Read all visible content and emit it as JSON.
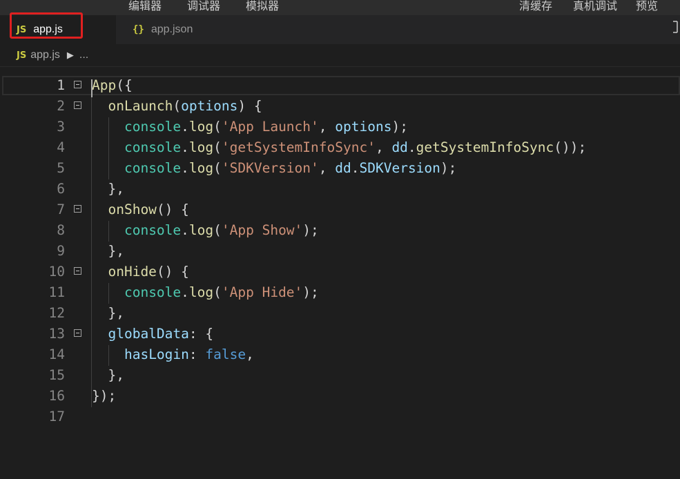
{
  "toolbar": {
    "items": [
      "编辑器",
      "调试器",
      "模拟器",
      "清缓存",
      "真机调试",
      "预览"
    ]
  },
  "tabs": [
    {
      "icon": "JS",
      "label": "app.js",
      "active": true
    },
    {
      "icon": "{}",
      "label": "app.json",
      "active": false
    }
  ],
  "tabs_action_icon": "split-editor-icon",
  "breadcrumb": {
    "icon": "JS",
    "file": "app.js",
    "separator": "▶",
    "more": "..."
  },
  "colors": {
    "highlight_box": "#e02020",
    "background": "#1e1e1e",
    "function": "#dcdcaa",
    "variable": "#9cdcfe",
    "object": "#4ec9b0",
    "string": "#ce9178",
    "keyword": "#569cd6"
  },
  "editor": {
    "active_line": 1,
    "lines": [
      {
        "n": "1",
        "fold": true,
        "tokens": [
          [
            "fn",
            "App"
          ],
          [
            "p",
            "({"
          ]
        ]
      },
      {
        "n": "2",
        "fold": true,
        "tokens": [
          [
            "p",
            "  "
          ],
          [
            "fn",
            "onLaunch"
          ],
          [
            "p",
            "("
          ],
          [
            "var",
            "options"
          ],
          [
            "p",
            ") {"
          ]
        ]
      },
      {
        "n": "3",
        "fold": false,
        "tokens": [
          [
            "p",
            "    "
          ],
          [
            "obj",
            "console"
          ],
          [
            "p",
            "."
          ],
          [
            "fn",
            "log"
          ],
          [
            "p",
            "("
          ],
          [
            "str",
            "'App Launch'"
          ],
          [
            "p",
            ", "
          ],
          [
            "var",
            "options"
          ],
          [
            "p",
            ");"
          ]
        ]
      },
      {
        "n": "4",
        "fold": false,
        "tokens": [
          [
            "p",
            "    "
          ],
          [
            "obj",
            "console"
          ],
          [
            "p",
            "."
          ],
          [
            "fn",
            "log"
          ],
          [
            "p",
            "("
          ],
          [
            "str",
            "'getSystemInfoSync'"
          ],
          [
            "p",
            ", "
          ],
          [
            "var",
            "dd"
          ],
          [
            "p",
            "."
          ],
          [
            "fn",
            "getSystemInfoSync"
          ],
          [
            "p",
            "());"
          ]
        ]
      },
      {
        "n": "5",
        "fold": false,
        "tokens": [
          [
            "p",
            "    "
          ],
          [
            "obj",
            "console"
          ],
          [
            "p",
            "."
          ],
          [
            "fn",
            "log"
          ],
          [
            "p",
            "("
          ],
          [
            "str",
            "'SDKVersion'"
          ],
          [
            "p",
            ", "
          ],
          [
            "var",
            "dd"
          ],
          [
            "p",
            "."
          ],
          [
            "var",
            "SDKVersion"
          ],
          [
            "p",
            ");"
          ]
        ]
      },
      {
        "n": "6",
        "fold": false,
        "tokens": [
          [
            "p",
            "  },"
          ]
        ]
      },
      {
        "n": "7",
        "fold": true,
        "tokens": [
          [
            "p",
            "  "
          ],
          [
            "fn",
            "onShow"
          ],
          [
            "p",
            "() {"
          ]
        ]
      },
      {
        "n": "8",
        "fold": false,
        "tokens": [
          [
            "p",
            "    "
          ],
          [
            "obj",
            "console"
          ],
          [
            "p",
            "."
          ],
          [
            "fn",
            "log"
          ],
          [
            "p",
            "("
          ],
          [
            "str",
            "'App Show'"
          ],
          [
            "p",
            ");"
          ]
        ]
      },
      {
        "n": "9",
        "fold": false,
        "tokens": [
          [
            "p",
            "  },"
          ]
        ]
      },
      {
        "n": "10",
        "fold": true,
        "tokens": [
          [
            "p",
            "  "
          ],
          [
            "fn",
            "onHide"
          ],
          [
            "p",
            "() {"
          ]
        ]
      },
      {
        "n": "11",
        "fold": false,
        "tokens": [
          [
            "p",
            "    "
          ],
          [
            "obj",
            "console"
          ],
          [
            "p",
            "."
          ],
          [
            "fn",
            "log"
          ],
          [
            "p",
            "("
          ],
          [
            "str",
            "'App Hide'"
          ],
          [
            "p",
            ");"
          ]
        ]
      },
      {
        "n": "12",
        "fold": false,
        "tokens": [
          [
            "p",
            "  },"
          ]
        ]
      },
      {
        "n": "13",
        "fold": true,
        "tokens": [
          [
            "p",
            "  "
          ],
          [
            "var",
            "globalData"
          ],
          [
            "p",
            ": {"
          ]
        ]
      },
      {
        "n": "14",
        "fold": false,
        "tokens": [
          [
            "p",
            "    "
          ],
          [
            "var",
            "hasLogin"
          ],
          [
            "p",
            ": "
          ],
          [
            "kw",
            "false"
          ],
          [
            "p",
            ","
          ]
        ]
      },
      {
        "n": "15",
        "fold": false,
        "tokens": [
          [
            "p",
            "  },"
          ]
        ]
      },
      {
        "n": "16",
        "fold": false,
        "tokens": [
          [
            "p",
            "});"
          ]
        ]
      },
      {
        "n": "17",
        "fold": false,
        "tokens": []
      }
    ]
  }
}
